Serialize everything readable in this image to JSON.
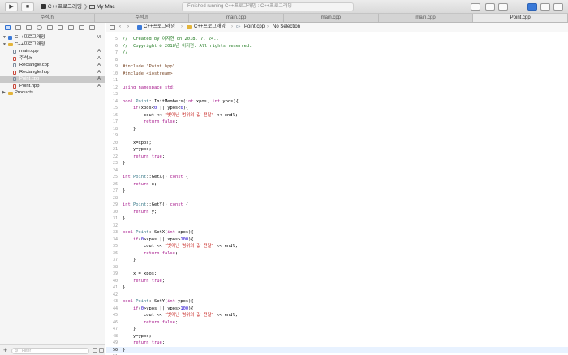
{
  "toolbar": {
    "play_icon": "play-icon",
    "stop_icon": "stop-icon",
    "scheme_name": "C++프로그래밍",
    "destination": "My Mac",
    "status_text": "Finished running C++프로그래밍 : C++프로그래밍"
  },
  "tabs": [
    {
      "label": "주석.h",
      "active": false
    },
    {
      "label": "주석.h",
      "active": false
    },
    {
      "label": "main.cpp",
      "active": false
    },
    {
      "label": "main.cpp",
      "active": false
    },
    {
      "label": "main.cpp",
      "active": false
    },
    {
      "label": "Point.cpp",
      "active": true
    }
  ],
  "navigator": {
    "project": {
      "label": "C++프로그래밍",
      "badge": "M"
    },
    "items": [
      {
        "label": "C++프로그래밍",
        "badge": "",
        "indent": 1,
        "type": "folder",
        "color": "#e3b43a"
      },
      {
        "label": "main.cpp",
        "badge": "A",
        "indent": 2,
        "type": "cpp",
        "color": "#7a8a9a"
      },
      {
        "label": "주석.h",
        "badge": "A",
        "indent": 2,
        "type": "h",
        "color": "#c9483b"
      },
      {
        "label": "Rectangle.cpp",
        "badge": "A",
        "indent": 2,
        "type": "cpp",
        "color": "#7a8a9a"
      },
      {
        "label": "Rectangle.hpp",
        "badge": "A",
        "indent": 2,
        "type": "h",
        "color": "#c9483b"
      },
      {
        "label": "Point.cpp",
        "badge": "A",
        "indent": 2,
        "type": "cpp",
        "color": "#7a8a9a",
        "selected": true
      },
      {
        "label": "Point.hpp",
        "badge": "A",
        "indent": 2,
        "type": "h",
        "color": "#c9483b"
      },
      {
        "label": "Products",
        "badge": "",
        "indent": 1,
        "type": "folder",
        "color": "#e3b43a"
      }
    ],
    "filter_placeholder": "Filter"
  },
  "jump_bar": {
    "crumb1": "C++프로그래밍",
    "crumb2": "C++프로그래밍",
    "crumb3": "Point.cpp",
    "crumb4": "No Selection"
  },
  "editor": {
    "current_line": 50,
    "lines": [
      {
        "n": 5,
        "t": "//  Created by 이지현 on 2018. 7. 24..",
        "c": "cmt"
      },
      {
        "n": 6,
        "t": "//  Copyright © 2018년 이지현. All rights reserved.",
        "c": "cmt"
      },
      {
        "n": 7,
        "t": "//",
        "c": "cmt"
      },
      {
        "n": 8,
        "t": "",
        "c": ""
      },
      {
        "n": 9,
        "t": "#include \"Point.hpp\"",
        "c": "pp"
      },
      {
        "n": 10,
        "t": "#include <iostream>",
        "c": "pp"
      },
      {
        "n": 11,
        "t": "",
        "c": ""
      },
      {
        "n": 12,
        "t": "using namespace std;",
        "c": "kw"
      },
      {
        "n": 13,
        "t": "",
        "c": ""
      },
      {
        "n": 14,
        "t": "bool Point::InitMembers(int xpos, int ypos){",
        "c": ""
      },
      {
        "n": 15,
        "t": "    if(xpos<0 || ypos<0){",
        "c": ""
      },
      {
        "n": 16,
        "t": "        cout << \"벗어난 범위의 값 전달\" << endl;",
        "c": ""
      },
      {
        "n": 17,
        "t": "        return false;",
        "c": ""
      },
      {
        "n": 18,
        "t": "    }",
        "c": ""
      },
      {
        "n": 19,
        "t": "",
        "c": ""
      },
      {
        "n": 20,
        "t": "    x=xpos;",
        "c": ""
      },
      {
        "n": 21,
        "t": "    y=ypos;",
        "c": ""
      },
      {
        "n": 22,
        "t": "    return true;",
        "c": ""
      },
      {
        "n": 23,
        "t": "}",
        "c": ""
      },
      {
        "n": 24,
        "t": "",
        "c": ""
      },
      {
        "n": 25,
        "t": "int Point::GetX() const {",
        "c": ""
      },
      {
        "n": 26,
        "t": "    return x;",
        "c": ""
      },
      {
        "n": 27,
        "t": "}",
        "c": ""
      },
      {
        "n": 28,
        "t": "",
        "c": ""
      },
      {
        "n": 29,
        "t": "int Point::GetY() const {",
        "c": ""
      },
      {
        "n": 30,
        "t": "    return y;",
        "c": ""
      },
      {
        "n": 31,
        "t": "}",
        "c": ""
      },
      {
        "n": 32,
        "t": "",
        "c": ""
      },
      {
        "n": 33,
        "t": "bool Point::SetX(int xpos){",
        "c": ""
      },
      {
        "n": 34,
        "t": "    if(0>xpos || xpos>100){",
        "c": ""
      },
      {
        "n": 35,
        "t": "        cout << \"벗어난 범위의 값 전달\" << endl;",
        "c": ""
      },
      {
        "n": 36,
        "t": "        return false;",
        "c": ""
      },
      {
        "n": 37,
        "t": "    }",
        "c": ""
      },
      {
        "n": 38,
        "t": "",
        "c": ""
      },
      {
        "n": 39,
        "t": "    x = xpos;",
        "c": ""
      },
      {
        "n": 40,
        "t": "    return true;",
        "c": ""
      },
      {
        "n": 41,
        "t": "}",
        "c": ""
      },
      {
        "n": 42,
        "t": "",
        "c": ""
      },
      {
        "n": 43,
        "t": "bool Point::SetY(int ypos){",
        "c": ""
      },
      {
        "n": 44,
        "t": "    if(0>ypos || ypos>100){",
        "c": ""
      },
      {
        "n": 45,
        "t": "        cout << \"벗어난 범위의 값 전달\" << endl;",
        "c": ""
      },
      {
        "n": 46,
        "t": "        return false;",
        "c": ""
      },
      {
        "n": 47,
        "t": "    }",
        "c": ""
      },
      {
        "n": 48,
        "t": "    y=ypos;",
        "c": ""
      },
      {
        "n": 49,
        "t": "    return true;",
        "c": ""
      },
      {
        "n": 50,
        "t": "}",
        "c": ""
      },
      {
        "n": 51,
        "t": "",
        "c": ""
      }
    ]
  },
  "colors": {
    "accent": "#3a79d8",
    "comment": "#1f7a1f",
    "keyword": "#a7198c",
    "string": "#c41a16"
  }
}
